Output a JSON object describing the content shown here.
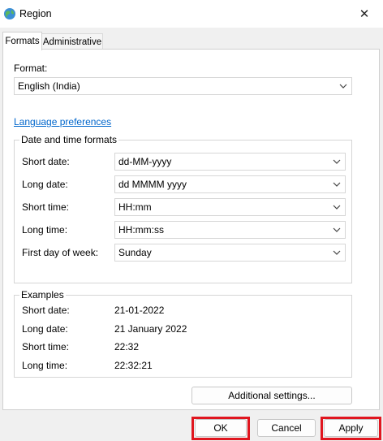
{
  "window": {
    "title": "Region",
    "close_glyph": "✕"
  },
  "tabs": [
    {
      "label": "Formats"
    },
    {
      "label": "Administrative"
    }
  ],
  "format": {
    "label": "Format:",
    "value": "English (India)"
  },
  "language_preferences_link": "Language preferences",
  "date_time_formats": {
    "title": "Date and time formats",
    "rows": [
      {
        "label": "Short date:",
        "value": "dd-MM-yyyy"
      },
      {
        "label": "Long date:",
        "value": "dd MMMM yyyy"
      },
      {
        "label": "Short time:",
        "value": "HH:mm"
      },
      {
        "label": "Long time:",
        "value": "HH:mm:ss"
      },
      {
        "label": "First day of week:",
        "value": "Sunday"
      }
    ]
  },
  "examples": {
    "title": "Examples",
    "rows": [
      {
        "label": "Short date:",
        "value": "21-01-2022"
      },
      {
        "label": "Long date:",
        "value": "21 January 2022"
      },
      {
        "label": "Short time:",
        "value": "22:32"
      },
      {
        "label": "Long time:",
        "value": "22:32:21"
      }
    ]
  },
  "buttons": {
    "additional_settings": "Additional settings...",
    "ok": "OK",
    "cancel": "Cancel",
    "apply": "Apply"
  },
  "colors": {
    "highlight": "#e0161f",
    "link": "#0066cc"
  },
  "icons": {
    "app": "globe-icon",
    "close": "close-icon",
    "dropdown": "chevron-down-icon"
  }
}
